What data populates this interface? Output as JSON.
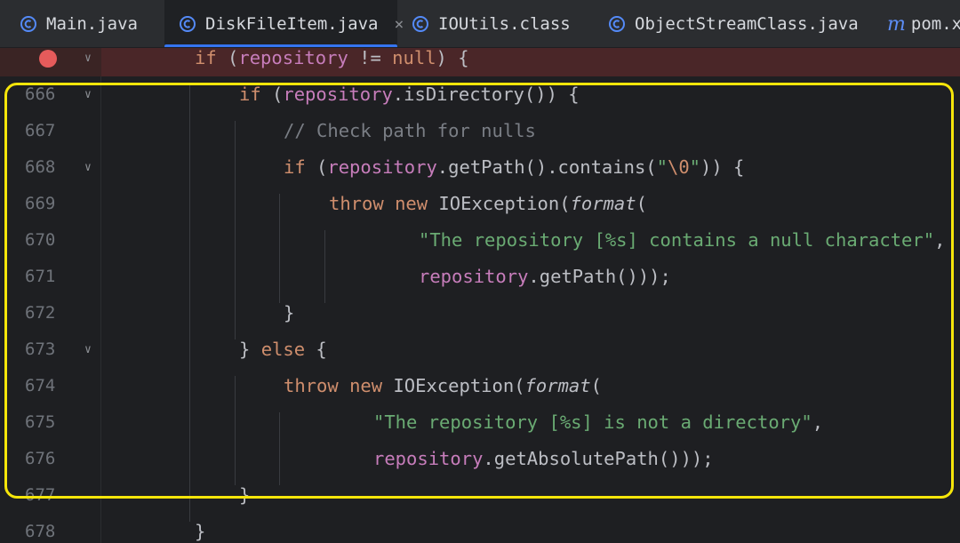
{
  "tabs": [
    {
      "label": "Main.java",
      "icon": "java-class-icon",
      "active": false
    },
    {
      "label": "DiskFileItem.java",
      "icon": "java-class-icon",
      "active": true,
      "close": "×"
    },
    {
      "label": "IOUtils.class",
      "icon": "java-class-icon",
      "active": false
    },
    {
      "label": "ObjectStreamClass.java",
      "icon": "java-class-icon",
      "active": false
    },
    {
      "label": "pom.xm",
      "icon": "maven-icon",
      "active": false
    }
  ],
  "line_numbers": [
    "666",
    "667",
    "668",
    "669",
    "670",
    "671",
    "672",
    "673",
    "674",
    "675",
    "676",
    "677",
    "678"
  ],
  "code": {
    "l665": {
      "kw_if": "if",
      "p1": " (",
      "repo": "repository",
      "op": " != ",
      "null": "null",
      "p2": ") {"
    },
    "l666": {
      "kw_if": "if",
      "p1": " (",
      "repo": "repository",
      "m": ".isDirectory()) {"
    },
    "l667": {
      "comment": "// Check path for nulls"
    },
    "l668": {
      "kw_if": "if",
      "p1": " (",
      "repo": "repository",
      "m": ".getPath().contains(",
      "s1": "\"",
      "esc": "\\0",
      "s2": "\"",
      "end": ")) {"
    },
    "l669": {
      "kw_throw": "throw",
      "kw_new": "new",
      "cls": " IOException(",
      "fmt": "format",
      "p": "("
    },
    "l670": {
      "str": "\"The repository [%s] contains a null character\"",
      "comma": ","
    },
    "l671": {
      "repo": "repository",
      "m": ".getPath()));"
    },
    "l672": {
      "brace": "}"
    },
    "l673": {
      "b1": "} ",
      "kw_else": "else",
      "b2": " {"
    },
    "l674": {
      "kw_throw": "throw",
      "kw_new": "new",
      "cls": " IOException(",
      "fmt": "format",
      "p": "("
    },
    "l675": {
      "str": "\"The repository [%s] is not a directory\"",
      "comma": ","
    },
    "l676": {
      "repo": "repository",
      "m": ".getAbsolutePath()));"
    },
    "l677": {
      "brace": "}"
    },
    "l678": {
      "brace": "}"
    }
  },
  "colors": {
    "keyword": "#cf8e6d",
    "field": "#c77dbb",
    "string": "#6aab73",
    "comment": "#7a7e85",
    "highlight": "#f5e50a",
    "breakpoint": "#e55b5b"
  }
}
